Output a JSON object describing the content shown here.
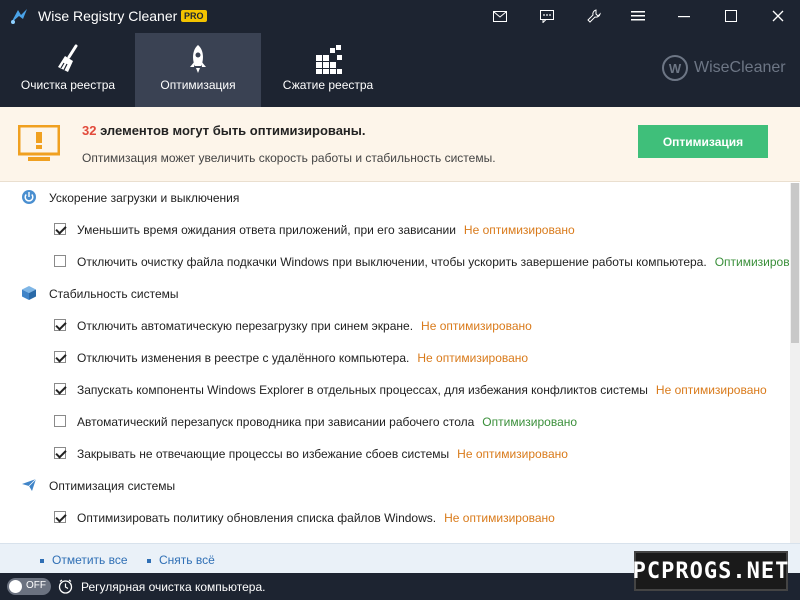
{
  "app": {
    "title": "Wise Registry Cleaner X",
    "badge": "PRO"
  },
  "titlebar_icons": [
    "mail-icon",
    "feedback-icon",
    "settings-wrench-icon",
    "menu-icon",
    "minimize-icon",
    "maximize-icon",
    "close-icon"
  ],
  "nav": {
    "tabs": [
      {
        "label": "Очистка реестра",
        "icon": "broom-icon"
      },
      {
        "label": "Оптимизация",
        "icon": "rocket-icon",
        "active": true
      },
      {
        "label": "Сжатие реестра",
        "icon": "compress-blocks-icon"
      }
    ],
    "brand": "WiseCleaner",
    "brand_letter": "W"
  },
  "banner": {
    "count": "32",
    "headline": " элементов могут быть оптимизированы.",
    "subtitle": "Оптимизация может увеличить скорость работы и стабильность системы.",
    "button": "Оптимизация"
  },
  "sections": [
    {
      "title": "Ускорение загрузки и выключения",
      "icon": "power-icon",
      "items": [
        {
          "text": "Уменьшить время ожидания ответа приложений, при его зависании",
          "status": "Не оптимизировано",
          "checked": true
        },
        {
          "text": "Отключить очистку файла подкачки Windows при выключении, чтобы ускорить завершение работы компьютера.",
          "status": "Оптимизировано",
          "checked": false
        }
      ]
    },
    {
      "title": "Стабильность системы",
      "icon": "cube-icon",
      "items": [
        {
          "text": "Отключить автоматическую перезагрузку при синем экране.",
          "status": "Не оптимизировано",
          "checked": true
        },
        {
          "text": "Отключить изменения в реестре с удалённого компьютера.",
          "status": "Не оптимизировано",
          "checked": true
        },
        {
          "text": "Запускать компоненты Windows Explorer в отдельных процессах, для избежания конфликтов системы",
          "status": "Не оптимизировано",
          "checked": true
        },
        {
          "text": "Автоматический перезапуск проводника при зависании рабочего стола",
          "status": "Оптимизировано",
          "checked": false
        },
        {
          "text": "Закрывать не отвечающие процессы во избежание сбоев системы",
          "status": "Не оптимизировано",
          "checked": true
        }
      ]
    },
    {
      "title": "Оптимизация системы",
      "icon": "paper-plane-icon",
      "items": [
        {
          "text": "Оптимизировать политику обновления списка файлов Windows.",
          "status": "Не оптимизировано",
          "checked": true
        }
      ]
    }
  ],
  "links": {
    "select_all": "Отметить все",
    "deselect_all": "Снять всё"
  },
  "status": {
    "toggle": "OFF",
    "text": "Регулярная очистка компьютера."
  },
  "watermark": "PCPROGS.NET",
  "colors": {
    "accent_green": "#3fbf7a",
    "warning_orange": "#d97a1a",
    "ok_green": "#3a8f3a",
    "count_red": "#e24a3b",
    "titlebar_bg": "#1d2431"
  }
}
